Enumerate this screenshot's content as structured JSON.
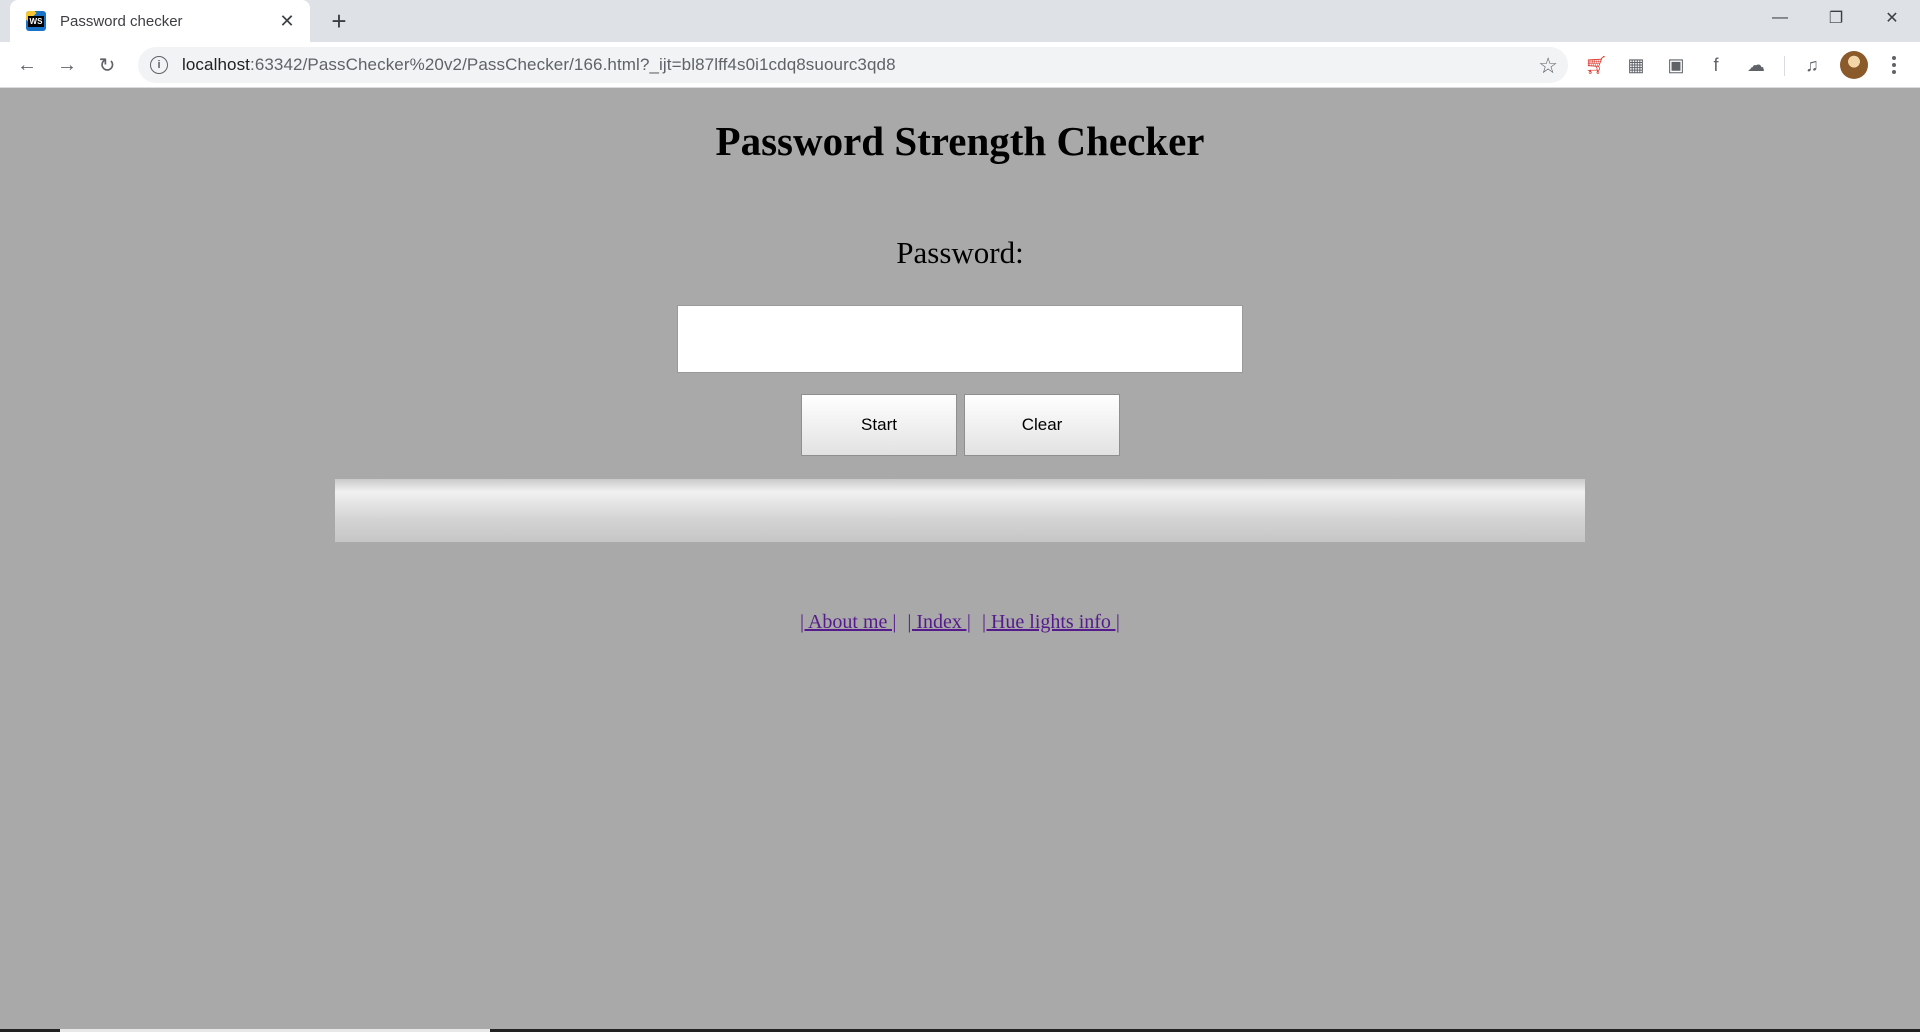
{
  "browser": {
    "tab": {
      "title": "Password checker",
      "favicon": "webstorm-icon"
    },
    "new_tab_label": "+",
    "url": {
      "host": "localhost",
      "path": ":63342/PassChecker%20v2/PassChecker/166.html?_ijt=bl87lff4s0i1cdq8suourc3qd8"
    },
    "extensions": [
      "cart-icon",
      "qr-code-icon",
      "k-extension-icon",
      "facebook-icon",
      "cloud-icon",
      "media-queue-icon"
    ]
  },
  "page": {
    "title": "Password Strength Checker",
    "password_label": "Password:",
    "password_value": "",
    "buttons": {
      "start": "Start",
      "clear": "Clear"
    },
    "strength_meter": {
      "fraction": 0
    },
    "links": [
      {
        "label": " About me "
      },
      {
        "label": " Index "
      },
      {
        "label": " Hue lights info "
      }
    ]
  }
}
